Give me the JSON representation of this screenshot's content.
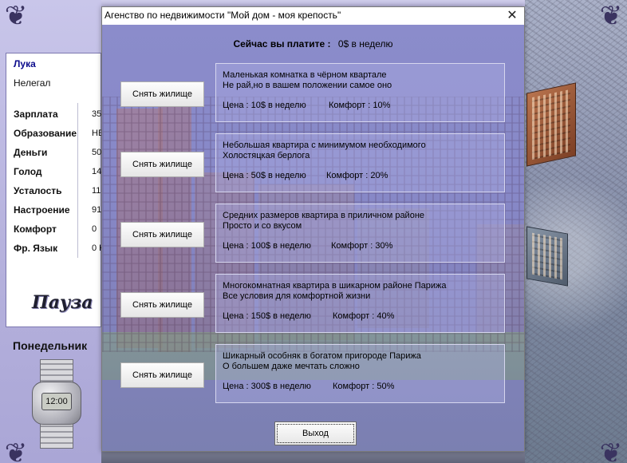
{
  "character": {
    "name": "Лука",
    "status": "Нелегал",
    "stats": [
      {
        "label": "Зарплата",
        "value": "35"
      },
      {
        "label": "Образование",
        "value": "НЕ"
      },
      {
        "label": "Деньги",
        "value": "50"
      },
      {
        "label": "Голод",
        "value": "14"
      },
      {
        "label": "Усталость",
        "value": "11"
      },
      {
        "label": "Настроение",
        "value": "91"
      },
      {
        "label": "Комфорт",
        "value": "0"
      },
      {
        "label": "Фр. Язык",
        "value": "0 K"
      }
    ]
  },
  "pause_label": "Пауза",
  "day_label": "Понедельник",
  "clock_time": "12:00",
  "dialog": {
    "title": "Агенство по недвижимости \"Мой дом - моя крепость\"",
    "close_glyph": "✕",
    "pay_label": "Сейчас вы платите :",
    "pay_value": "0$ в неделю",
    "rent_label": "Снять жилище",
    "exit_label": "Выход",
    "listings": [
      {
        "line1": "Маленькая комнатка в чёрном квартале",
        "line2": "Не рай,но в вашем положении самое оно",
        "price": "Цена : 10$ в неделю",
        "comfort": "Комфорт : 10%"
      },
      {
        "line1": "Небольшая квартира с минимумом необходимого",
        "line2": "Холостяцкая берлога",
        "price": "Цена : 50$ в неделю",
        "comfort": "Комфорт : 20%"
      },
      {
        "line1": "Средних размеров квартира в приличном районе",
        "line2": "Просто и со вкусом",
        "price": "Цена : 100$ в неделю",
        "comfort": "Комфорт : 30%"
      },
      {
        "line1": "Многокомнатная квартира в шикарном районе Парижа",
        "line2": "Все условия для комфортной жизни",
        "price": "Цена : 150$ в неделю",
        "comfort": "Комфорт : 40%"
      },
      {
        "line1": "Шикарный особняк в богатом пригороде Парижа",
        "line2": "О большем даже мечтать сложно",
        "price": "Цена : 300$ в неделю",
        "comfort": "Комфорт : 50%"
      }
    ]
  },
  "icons": {
    "ornament": "scroll-ornament-icon",
    "watch": "wristwatch-icon"
  }
}
